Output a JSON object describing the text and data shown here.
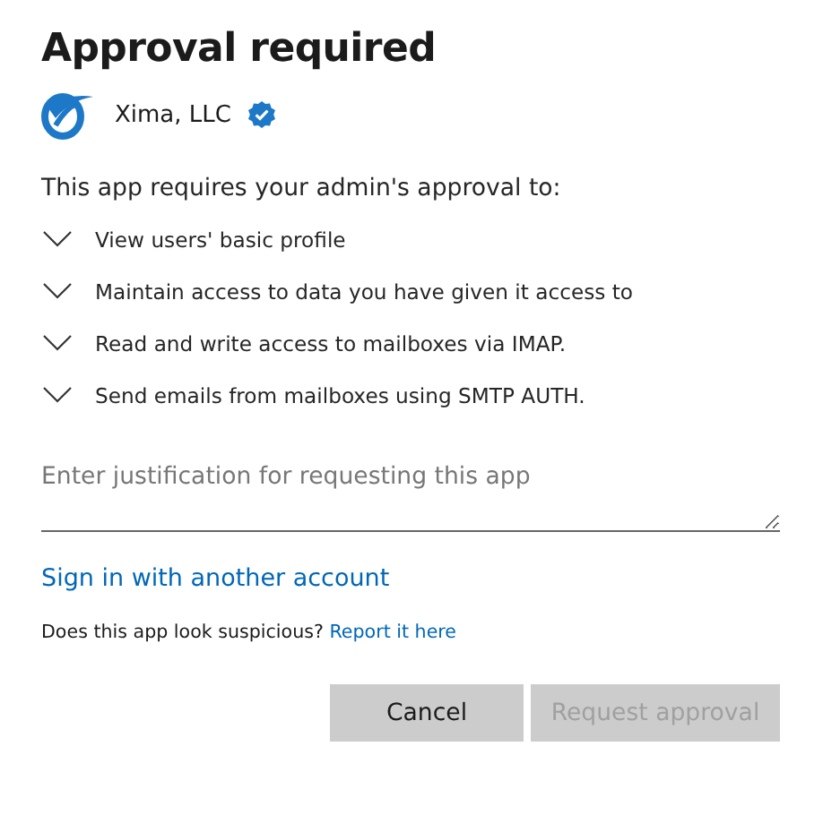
{
  "title": "Approval required",
  "publisher": {
    "name": "Xima, LLC",
    "verified": true
  },
  "intro": "This app requires your admin's approval to:",
  "permissions": [
    {
      "label": "View users' basic profile",
      "expanded": false
    },
    {
      "label": "Maintain access to data you have given it access to",
      "expanded": false
    },
    {
      "label": "Read and write access to mailboxes via IMAP.",
      "expanded": false
    },
    {
      "label": "Send emails from mailboxes using SMTP AUTH.",
      "expanded": false
    }
  ],
  "justification": {
    "placeholder": "Enter justification for requesting this app"
  },
  "other_account_link": "Sign in with another account",
  "suspicious": {
    "text": "Does this app look suspicious?",
    "link": "Report it here"
  },
  "buttons": [
    {
      "label": "Cancel",
      "disabled": false
    },
    {
      "label": "Request approval",
      "disabled": true
    }
  ]
}
